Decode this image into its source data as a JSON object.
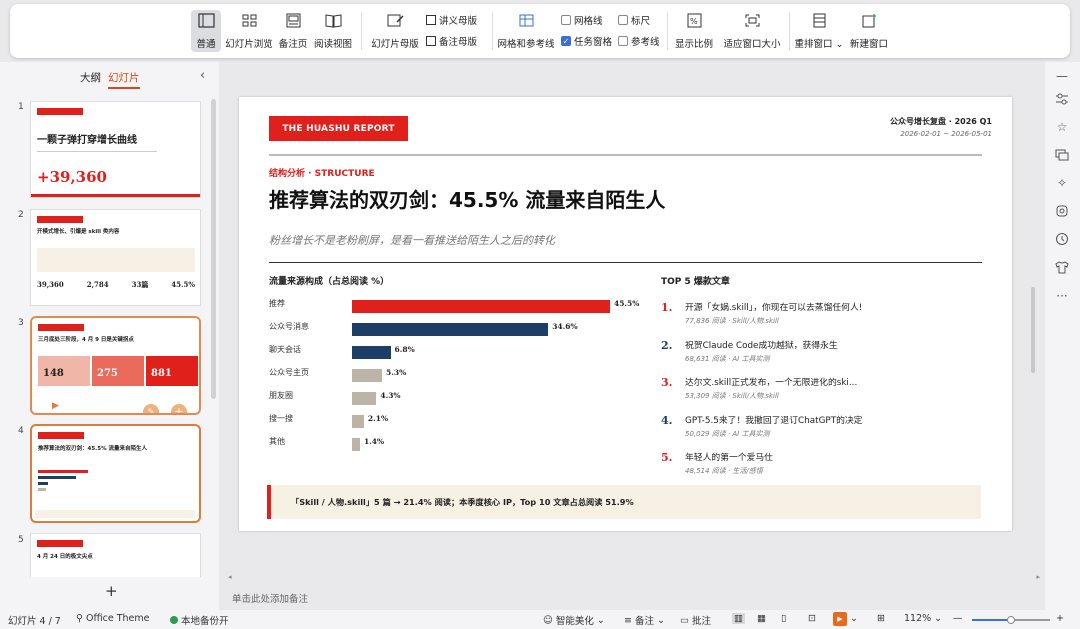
{
  "ribbon": {
    "normal": "普通",
    "slide_browse": "幻灯片浏览",
    "notes_page": "备注页",
    "reading_view": "阅读视图",
    "slide_master": "幻灯片母版",
    "handout_master": "讲义母版",
    "notes_master": "备注母版",
    "grid_guides": "网格和参考线",
    "gridlines": "网格线",
    "ruler": "标尺",
    "task_pane": "任务窗格",
    "guides": "参考线",
    "zoom_ratio": "显示比例",
    "fit_window": "适应窗口大小",
    "rearrange": "重排窗口",
    "new_window": "新建窗口"
  },
  "left_panel": {
    "tab_outline": "大纲",
    "tab_slides": "幻灯片",
    "add_label": "+",
    "thumbs": [
      {
        "num": "1",
        "title": "一颗子弹打穿增长曲线",
        "big": "+39,360"
      },
      {
        "num": "2",
        "title": "开模式增长、引爆是 skill 类内容",
        "stats": [
          "39,360",
          "2,784",
          "33篇",
          "45.5%"
        ]
      },
      {
        "num": "3",
        "title": "三月底处三阶段，4 月 9 日是关键拐点",
        "stats": [
          "148",
          "275",
          "881"
        ]
      },
      {
        "num": "4",
        "title": "推荐算法的双刃剑：45.5% 流量来自陌生人"
      },
      {
        "num": "5",
        "title": "4 月 24 日的极文尖点"
      }
    ]
  },
  "slide": {
    "banner": "THE HUASHU REPORT",
    "top_right_title": "公众号增长复盘 · 2026 Q1",
    "top_right_date": "2026-02-01 ~ 2026-05-01",
    "kicker": "结构分析 · STRUCTURE",
    "title": "推荐算法的双刃剑：45.5% 流量来自陌生人",
    "subtitle": "粉丝增长不是老粉刷屏，是看一看推送给陌生人之后的转化",
    "chart_title": "流量来源构成（占总阅读 %）",
    "top_title": "TOP 5 爆款文章",
    "callout": "「Skill / 人物.skill」5 篇 → 21.4% 阅读；本季度核心 IP，Top 10 文章占总阅读 51.9%",
    "top_articles": [
      {
        "rank": "1.",
        "title": "开源「女娲.skill」，你现在可以去蒸馏任何人!",
        "meta": "77,836 阅读 ·  Skill/人物.skill"
      },
      {
        "rank": "2.",
        "title": "祝贺Claude Code成功越狱，获得永生",
        "meta": "68,631 阅读 ·  AI 工具实测"
      },
      {
        "rank": "3.",
        "title": "达尔文.skill正式发布，一个无限进化的ski...",
        "meta": "53,309 阅读 ·  Skill/人物.skill"
      },
      {
        "rank": "4.",
        "title": "GPT-5.5来了！我撤回了退订ChatGPT的决定",
        "meta": "50,029 阅读 ·  AI 工具实测"
      },
      {
        "rank": "5.",
        "title": "年轻人的第一个爱马仕",
        "meta": "48,514 阅读 ·  生活/感悟"
      }
    ]
  },
  "chart_data": {
    "type": "bar",
    "title": "流量来源构成（占总阅读 %）",
    "categories": [
      "推荐",
      "公众号消息",
      "聊天会话",
      "公众号主页",
      "朋友圈",
      "搜一搜",
      "其他"
    ],
    "values": [
      45.5,
      34.6,
      6.8,
      5.3,
      4.3,
      2.1,
      1.4
    ],
    "value_labels": [
      "45.5%",
      "34.6%",
      "6.8%",
      "5.3%",
      "4.3%",
      "2.1%",
      "1.4%"
    ],
    "colors": [
      "#e0201a",
      "#1d3f66",
      "#1d3f66",
      "#bdb4a8",
      "#bdb4a8",
      "#bdb4a8",
      "#bdb4a8"
    ],
    "xlim": [
      0,
      45.5
    ]
  },
  "notes_placeholder": "单击此处添加备注",
  "status": {
    "slide_count": "幻灯片 4 / 7",
    "theme": "Office Theme",
    "backup": "本地备份开",
    "beautify": "智能美化",
    "notes": "备注",
    "comments": "批注",
    "zoom": "112%"
  },
  "colors": {
    "accent": "#e0201a",
    "navy": "#1d3f66",
    "beige": "#bdb4a8",
    "orange_sel": "#e07b3a"
  }
}
